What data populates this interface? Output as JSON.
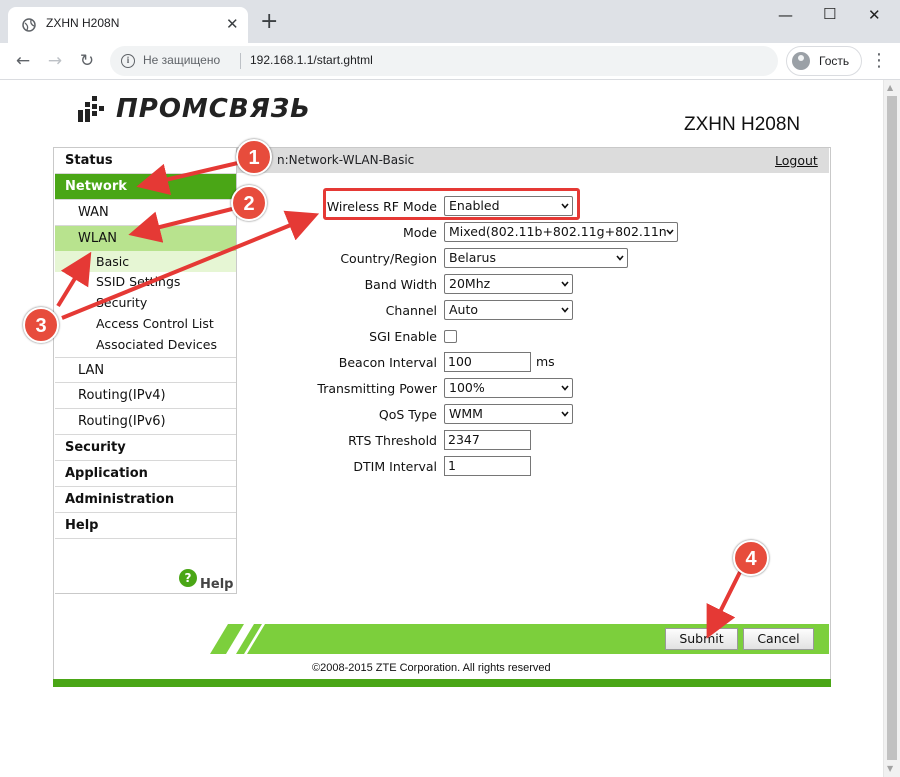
{
  "browser": {
    "tab_title": "ZXHN H208N",
    "not_secure": "Не защищено",
    "url": "192.168.1.1/start.ghtml",
    "profile_label": "Гость"
  },
  "header": {
    "logo_text": "ПРОМСВЯЗЬ",
    "model": "ZXHN H208N"
  },
  "sidebar": {
    "status": "Status",
    "network": "Network",
    "wan": "WAN",
    "wlan": "WLAN",
    "basic": "Basic",
    "ssid_settings": "SSID Settings",
    "security_sub": "Security",
    "access_control_list": "Access Control List",
    "associated_devices": "Associated Devices",
    "lan": "LAN",
    "routing_ipv4": "Routing(IPv4)",
    "routing_ipv6": "Routing(IPv6)",
    "security": "Security",
    "application": "Application",
    "administration": "Administration",
    "help": "Help",
    "help_link": "Help"
  },
  "pathbar": {
    "path": "n:Network-WLAN-Basic",
    "logout": "Logout"
  },
  "form": {
    "wireless_rf_mode": {
      "label": "Wireless RF Mode",
      "value": "Enabled"
    },
    "mode": {
      "label": "Mode",
      "value": "Mixed(802.11b+802.11g+802.11n"
    },
    "country": {
      "label": "Country/Region",
      "value": "Belarus"
    },
    "band_width": {
      "label": "Band Width",
      "value": "20Mhz"
    },
    "channel": {
      "label": "Channel",
      "value": "Auto"
    },
    "sgi_enable": {
      "label": "SGI Enable",
      "checked": false
    },
    "beacon_interval": {
      "label": "Beacon Interval",
      "value": "100",
      "unit": "ms"
    },
    "transmitting_power": {
      "label": "Transmitting Power",
      "value": "100%"
    },
    "qos_type": {
      "label": "QoS Type",
      "value": "WMM"
    },
    "rts_threshold": {
      "label": "RTS Threshold",
      "value": "2347"
    },
    "dtim_interval": {
      "label": "DTIM Interval",
      "value": "1"
    }
  },
  "buttons": {
    "submit": "Submit",
    "cancel": "Cancel"
  },
  "footer": {
    "copyright": "©2008-2015 ZTE Corporation. All rights reserved"
  },
  "annotations": [
    "1",
    "2",
    "3",
    "4"
  ],
  "colors": {
    "accent_green": "#4aa616",
    "annotation_red": "#e74c3c"
  }
}
